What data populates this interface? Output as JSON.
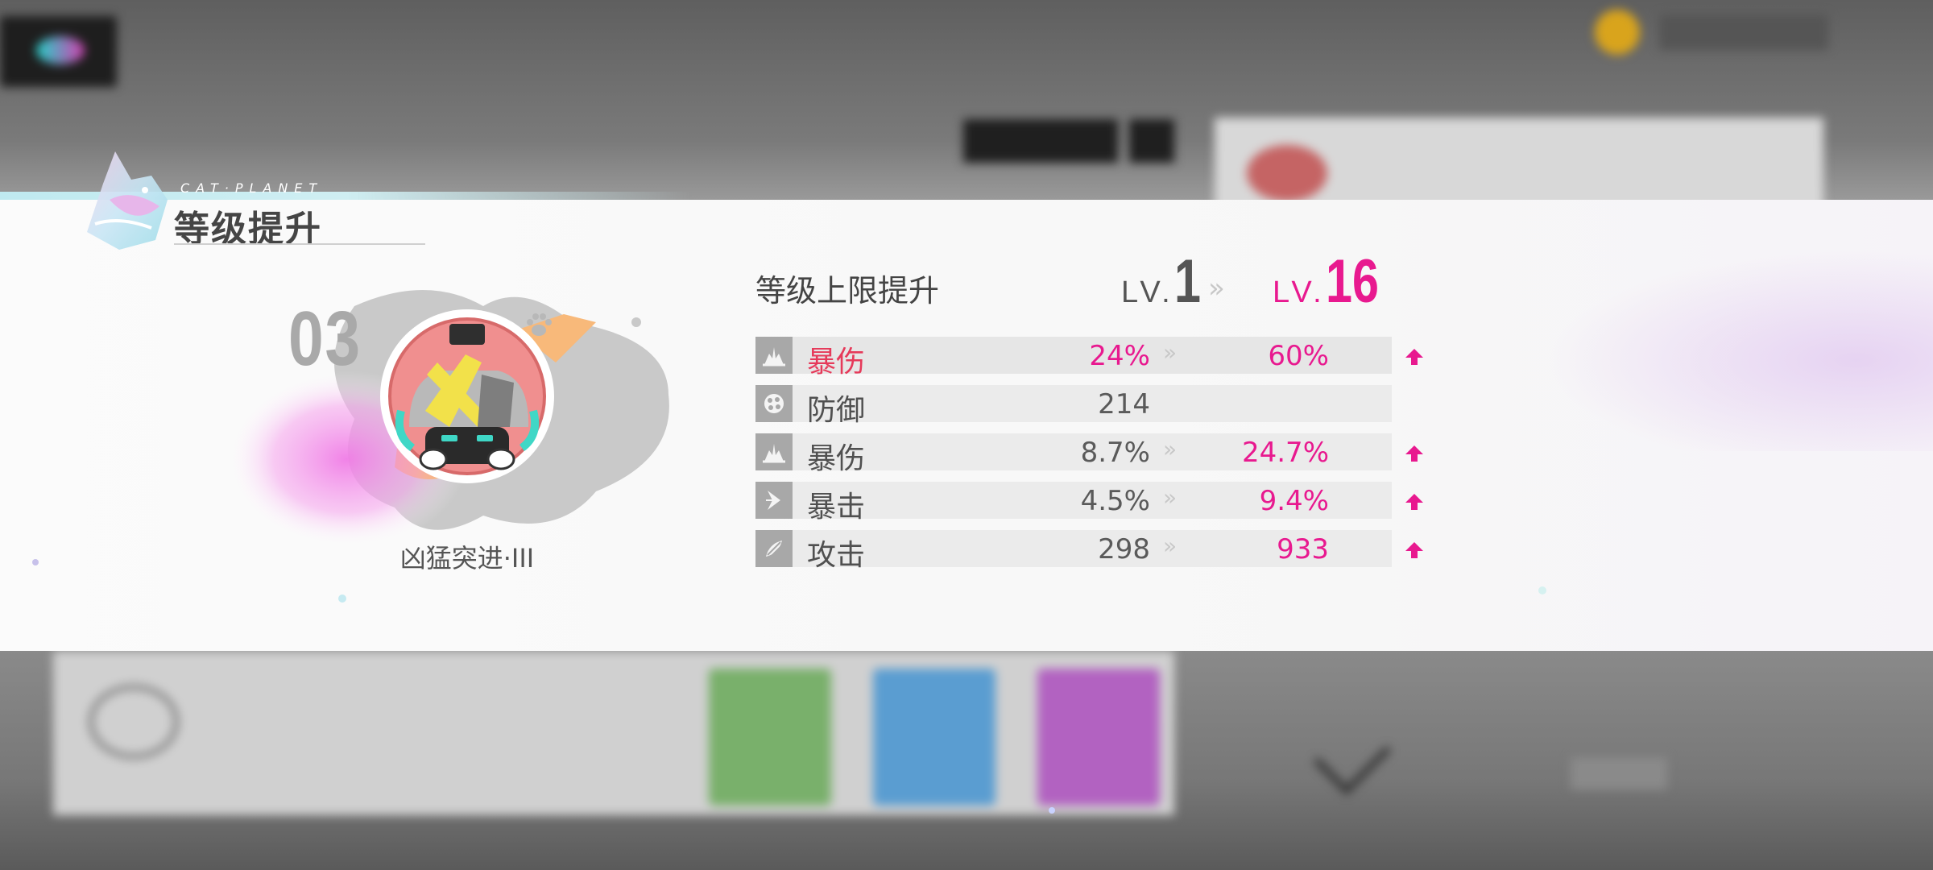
{
  "colors": {
    "accent": "#e8198f",
    "highlight_stat": "#e63a5a",
    "text_gray": "#555555",
    "banner": "#f9f9f9"
  },
  "header": {
    "brand": "CAT·PLANET",
    "title": "等级提升"
  },
  "item": {
    "number": "03",
    "name": "凶猛突进·III",
    "icon": "goggle-mask-emblem-icon"
  },
  "level": {
    "label": "等级上限提升",
    "prefix": "LV.",
    "old": "1",
    "new": "16",
    "arrow": "»"
  },
  "stats": [
    {
      "name": "暴伤",
      "icon": "crit-damage-icon",
      "old": "24%",
      "new": "60%",
      "upgraded": true,
      "highlight": true
    },
    {
      "name": "防御",
      "icon": "defense-icon",
      "old": "214",
      "new": "",
      "upgraded": false,
      "highlight": false
    },
    {
      "name": "暴伤",
      "icon": "crit-damage-icon",
      "old": "8.7%",
      "new": "24.7%",
      "upgraded": true,
      "highlight": false
    },
    {
      "name": "暴击",
      "icon": "crit-rate-icon",
      "old": "4.5%",
      "new": "9.4%",
      "upgraded": true,
      "highlight": false
    },
    {
      "name": "攻击",
      "icon": "attack-icon",
      "old": "298",
      "new": "933",
      "upgraded": true,
      "highlight": false
    }
  ],
  "stat_arrow": "»"
}
